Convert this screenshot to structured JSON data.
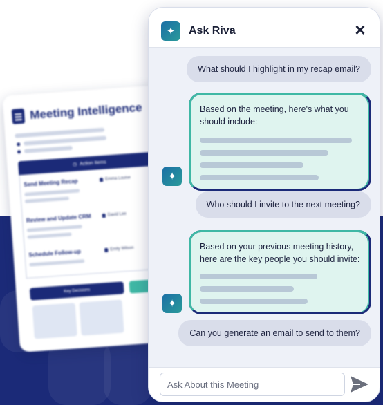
{
  "background_card": {
    "title": "Meeting Intelligence",
    "action_header": "Action Items",
    "items": [
      {
        "label": "Send Meeting Recap",
        "assignee": "Emma Louise"
      },
      {
        "label": "Review and Update CRM",
        "assignee": "David Lee"
      },
      {
        "label": "Schedule Follow-up",
        "assignee": "Emily Wilson"
      }
    ],
    "button_label": "Key Decisions"
  },
  "chat": {
    "title": "Ask Riva",
    "close_icon": "close-icon",
    "messages": [
      {
        "role": "user",
        "text": "What should I highlight in my recap email?"
      },
      {
        "role": "assistant",
        "text": "Based on the meeting, here's what you should include:"
      },
      {
        "role": "user",
        "text": "Who should I invite to the next meeting?"
      },
      {
        "role": "assistant",
        "text": "Based on your previous meeting history, here are the key people you should invite:"
      },
      {
        "role": "user",
        "text": "Can you generate an email to send to them?"
      }
    ],
    "input_placeholder": "Ask About this Meeting",
    "send_icon": "send-icon"
  },
  "colors": {
    "navy": "#1b2a78",
    "teal": "#3fb8a5",
    "bot_bubble_bg": "#dff4ef",
    "user_bubble_bg": "#d9ddea"
  }
}
